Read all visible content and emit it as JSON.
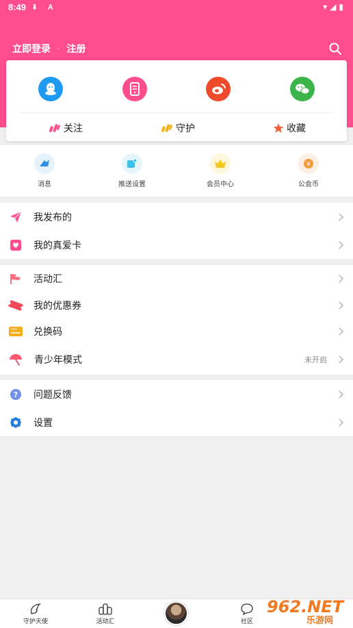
{
  "status_bar": {
    "time": "8:49",
    "left_icons": "⬇ A",
    "right_icons": "▾◢▮"
  },
  "header": {
    "login_label": "立即登录",
    "separator": "·",
    "register_label": "注册"
  },
  "card": {
    "social_icons": [
      "qq-icon",
      "phone-icon",
      "weibo-icon",
      "wechat-icon"
    ],
    "links": [
      {
        "label": "关注",
        "icon": "follow-icon"
      },
      {
        "label": "守护",
        "icon": "guard-icon"
      },
      {
        "label": "收藏",
        "icon": "star-icon"
      }
    ]
  },
  "quick_actions": [
    {
      "label": "消息",
      "icon": "message-icon"
    },
    {
      "label": "推送设置",
      "icon": "push-settings-icon"
    },
    {
      "label": "会员中心",
      "icon": "vip-crown-icon"
    },
    {
      "label": "公会币",
      "icon": "coin-icon"
    }
  ],
  "menu_groups": [
    {
      "items": [
        {
          "label": "我发布的",
          "icon": "send-icon",
          "value": ""
        },
        {
          "label": "我的真爱卡",
          "icon": "heart-card-icon",
          "value": ""
        }
      ]
    },
    {
      "items": [
        {
          "label": "活动汇",
          "icon": "flag-icon",
          "value": ""
        },
        {
          "label": "我的优惠券",
          "icon": "ticket-icon",
          "value": ""
        },
        {
          "label": "兑换码",
          "icon": "code-card-icon",
          "value": ""
        },
        {
          "label": "青少年模式",
          "icon": "umbrella-icon",
          "value": "未开启"
        }
      ]
    },
    {
      "items": [
        {
          "label": "问题反馈",
          "icon": "question-icon",
          "value": ""
        },
        {
          "label": "设置",
          "icon": "settings-gear-icon",
          "value": ""
        }
      ]
    }
  ],
  "tabbar": [
    {
      "label": "守护天使",
      "icon": "angel-wing-icon"
    },
    {
      "label": "活动汇",
      "icon": "activity-icon"
    },
    {
      "label": "社区",
      "icon": "chat-bubble-icon"
    }
  ],
  "watermark": {
    "text": "962.NET",
    "subtext": "乐游网"
  },
  "colors": {
    "brand_pink": "#ff4d8d",
    "qq_blue": "#1e9bf0",
    "weibo_red": "#f04a2d",
    "wechat_green": "#3bb54a",
    "settings_blue": "#2980d9"
  }
}
